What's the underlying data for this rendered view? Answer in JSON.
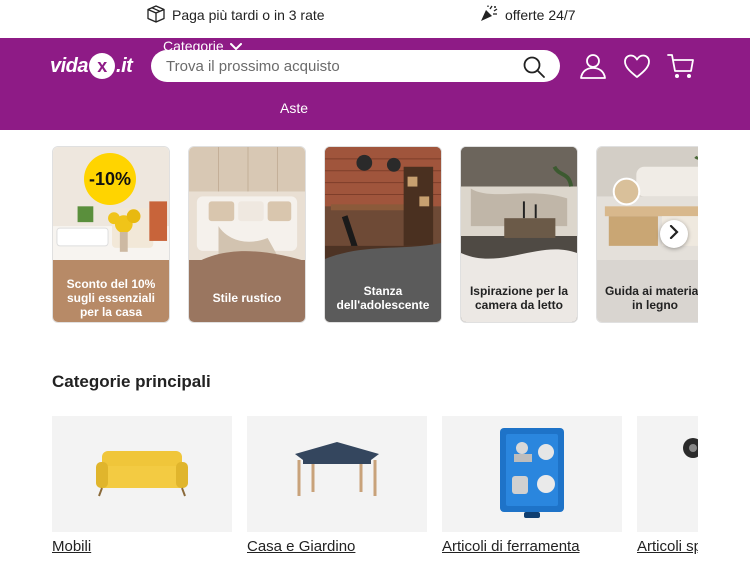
{
  "promo": {
    "left_text": "Paga più tardi o in 3 rate",
    "left_icon": "box-icon",
    "right_text": "offerte 24/7",
    "right_icon": "party-popper-icon"
  },
  "header": {
    "logo_main": "vida",
    "logo_x": "x",
    "logo_tld": ".it",
    "search_placeholder": "Trova il prossimo acquisto",
    "nav": {
      "categories_label": "Categorie",
      "auctions_label": "Aste"
    },
    "brand_color": "#8e1b86"
  },
  "stories": [
    {
      "caption": "Sconto del 10% sugli essenziali per la casa",
      "badge": "-10%",
      "caption_bg": "#b78a67"
    },
    {
      "caption": "Stile rustico",
      "caption_bg": "#9a7660"
    },
    {
      "caption": "Stanza dell'adolescente",
      "caption_bg": "#5b5b5b"
    },
    {
      "caption": "Ispirazione per la camera da letto",
      "caption_bg": "#ece8e4"
    },
    {
      "caption": "Guida ai materiali in legno",
      "caption_bg": "#d9d5d0"
    }
  ],
  "categories_section": {
    "title": "Categorie principali",
    "items": [
      {
        "label": "Mobili"
      },
      {
        "label": "Casa e Giardino"
      },
      {
        "label": "Articoli di ferramenta"
      },
      {
        "label": "Articoli sp"
      }
    ]
  }
}
